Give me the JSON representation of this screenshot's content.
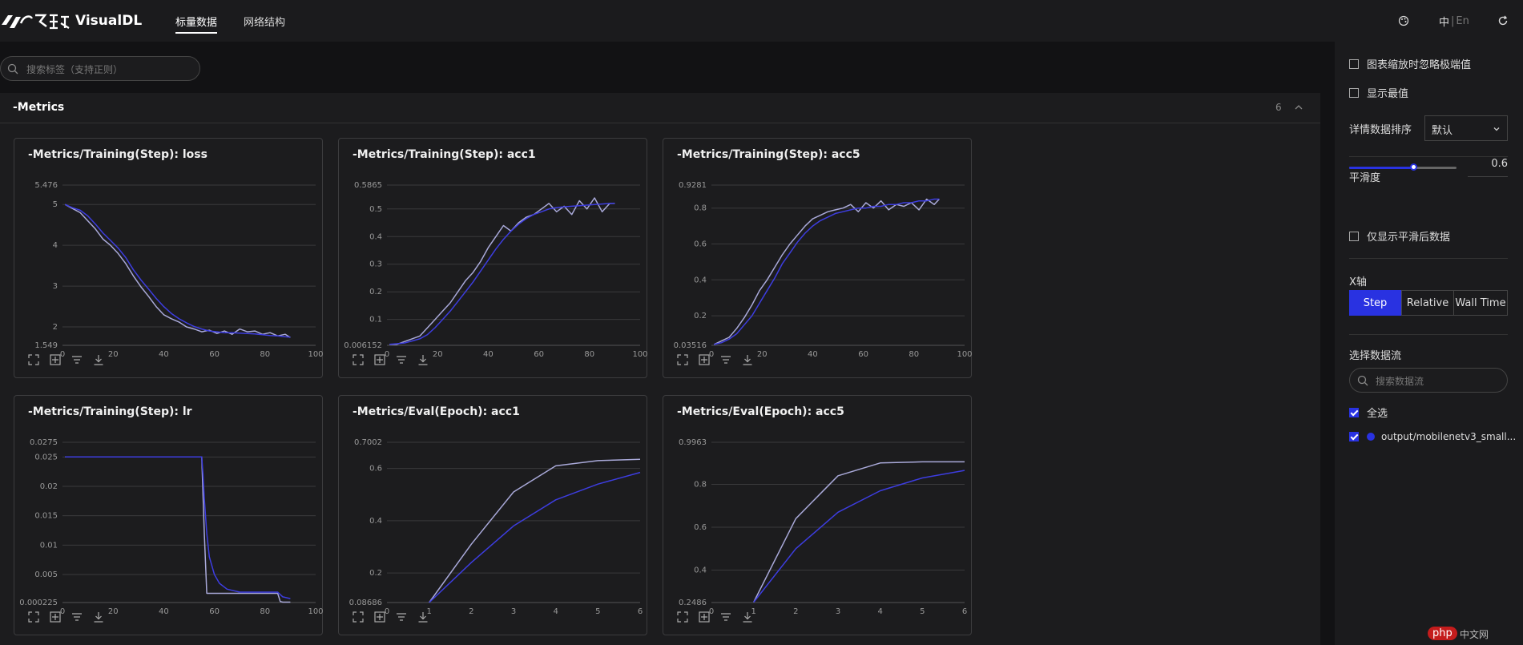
{
  "app": {
    "name": "VisualDL"
  },
  "nav": {
    "tabs": [
      {
        "label": "标量数据"
      },
      {
        "label": "网络结构"
      }
    ]
  },
  "topbar": {
    "lang_zh": "中",
    "lang_sep": "|",
    "lang_en": "En"
  },
  "search": {
    "placeholder": "搜索标签（支持正则）"
  },
  "section": {
    "title": "-Metrics",
    "count": "6"
  },
  "cards": [
    {
      "title": "-Metrics/Training(Step): loss",
      "chart_data": {
        "type": "line",
        "xlim": [
          0,
          100
        ],
        "ylim": [
          1.549,
          5.476
        ],
        "x_ticks": [
          "0",
          "20",
          "40",
          "60",
          "80",
          "100"
        ],
        "y_ticks": [
          {
            "label": "5.476",
            "v": 5.476
          },
          {
            "label": "5",
            "v": 5
          },
          {
            "label": "4",
            "v": 4
          },
          {
            "label": "3",
            "v": 3
          },
          {
            "label": "2",
            "v": 2
          },
          {
            "label": "1.549",
            "v": 1.549
          }
        ],
        "series": [
          {
            "x": [
              1,
              4,
              7,
              10,
              13,
              16,
              19,
              22,
              25,
              28,
              31,
              34,
              37,
              40,
              43,
              46,
              49,
              52,
              55,
              58,
              61,
              64,
              67,
              70,
              73,
              76,
              79,
              82,
              85,
              88,
              90
            ],
            "y": [
              5.0,
              4.92,
              4.86,
              4.72,
              4.52,
              4.3,
              4.12,
              3.93,
              3.7,
              3.4,
              3.15,
              2.93,
              2.7,
              2.5,
              2.33,
              2.2,
              2.1,
              2.01,
              1.95,
              1.9,
              1.88,
              1.86,
              1.86,
              1.85,
              1.84,
              1.83,
              1.81,
              1.79,
              1.78,
              1.76,
              1.75
            ]
          },
          {
            "x": [
              1,
              4,
              7,
              10,
              13,
              16,
              19,
              22,
              25,
              28,
              31,
              34,
              37,
              40,
              43,
              46,
              49,
              52,
              55,
              58,
              61,
              64,
              67,
              70,
              73,
              76,
              79,
              82,
              85,
              88,
              90
            ],
            "y": [
              5.0,
              4.9,
              4.8,
              4.6,
              4.4,
              4.15,
              4.0,
              3.8,
              3.55,
              3.25,
              2.98,
              2.75,
              2.5,
              2.3,
              2.2,
              2.12,
              2.0,
              1.95,
              1.88,
              1.92,
              1.84,
              1.9,
              1.82,
              1.95,
              1.88,
              1.9,
              1.82,
              1.86,
              1.78,
              1.82,
              1.74
            ]
          }
        ]
      }
    },
    {
      "title": "-Metrics/Training(Step): acc1",
      "chart_data": {
        "type": "line",
        "xlim": [
          0,
          100
        ],
        "ylim": [
          0.006152,
          0.5865
        ],
        "x_ticks": [
          "0",
          "20",
          "40",
          "60",
          "80",
          "100"
        ],
        "y_ticks": [
          {
            "label": "0.5865",
            "v": 0.5865
          },
          {
            "label": "0.5",
            "v": 0.5
          },
          {
            "label": "0.4",
            "v": 0.4
          },
          {
            "label": "0.3",
            "v": 0.3
          },
          {
            "label": "0.2",
            "v": 0.2
          },
          {
            "label": "0.1",
            "v": 0.1
          },
          {
            "label": "0.006152",
            "v": 0.006152
          }
        ],
        "series": [
          {
            "x": [
              1,
              4,
              7,
              10,
              13,
              16,
              19,
              22,
              25,
              28,
              31,
              34,
              37,
              40,
              43,
              46,
              49,
              52,
              55,
              58,
              61,
              64,
              67,
              70,
              73,
              76,
              79,
              82,
              85,
              88,
              90
            ],
            "y": [
              0.01,
              0.012,
              0.015,
              0.022,
              0.03,
              0.045,
              0.07,
              0.1,
              0.13,
              0.165,
              0.2,
              0.235,
              0.275,
              0.315,
              0.355,
              0.39,
              0.42,
              0.445,
              0.465,
              0.48,
              0.49,
              0.5,
              0.505,
              0.508,
              0.51,
              0.512,
              0.514,
              0.516,
              0.518,
              0.52,
              0.521
            ]
          },
          {
            "x": [
              1,
              4,
              7,
              10,
              13,
              16,
              19,
              22,
              25,
              28,
              31,
              34,
              37,
              40,
              43,
              46,
              49,
              52,
              55,
              58,
              61,
              64,
              67,
              70,
              73,
              76,
              79,
              82,
              85,
              88,
              90
            ],
            "y": [
              0.01,
              0.01,
              0.02,
              0.03,
              0.04,
              0.07,
              0.1,
              0.13,
              0.16,
              0.2,
              0.24,
              0.27,
              0.31,
              0.36,
              0.4,
              0.44,
              0.42,
              0.45,
              0.47,
              0.48,
              0.5,
              0.52,
              0.49,
              0.51,
              0.48,
              0.53,
              0.5,
              0.54,
              0.49,
              0.52,
              0.52
            ]
          }
        ]
      }
    },
    {
      "title": "-Metrics/Training(Step): acc5",
      "chart_data": {
        "type": "line",
        "xlim": [
          0,
          100
        ],
        "ylim": [
          0.03516,
          0.9281
        ],
        "x_ticks": [
          "0",
          "20",
          "40",
          "60",
          "80",
          "100"
        ],
        "y_ticks": [
          {
            "label": "0.9281",
            "v": 0.9281
          },
          {
            "label": "0.8",
            "v": 0.8
          },
          {
            "label": "0.6",
            "v": 0.6
          },
          {
            "label": "0.4",
            "v": 0.4
          },
          {
            "label": "0.2",
            "v": 0.2
          },
          {
            "label": "0.03516",
            "v": 0.03516
          }
        ],
        "series": [
          {
            "x": [
              1,
              4,
              7,
              10,
              13,
              16,
              19,
              22,
              25,
              28,
              31,
              34,
              37,
              40,
              43,
              46,
              49,
              52,
              55,
              58,
              61,
              64,
              67,
              70,
              73,
              76,
              79,
              82,
              85,
              88,
              90
            ],
            "y": [
              0.04,
              0.05,
              0.07,
              0.1,
              0.15,
              0.2,
              0.27,
              0.34,
              0.41,
              0.49,
              0.55,
              0.61,
              0.66,
              0.7,
              0.73,
              0.75,
              0.77,
              0.78,
              0.79,
              0.8,
              0.8,
              0.81,
              0.81,
              0.82,
              0.82,
              0.83,
              0.83,
              0.84,
              0.84,
              0.85,
              0.85
            ]
          },
          {
            "x": [
              1,
              4,
              7,
              10,
              13,
              16,
              19,
              22,
              25,
              28,
              31,
              34,
              37,
              40,
              43,
              46,
              49,
              52,
              55,
              58,
              61,
              64,
              67,
              70,
              73,
              76,
              79,
              82,
              85,
              88,
              90
            ],
            "y": [
              0.04,
              0.06,
              0.08,
              0.13,
              0.19,
              0.26,
              0.34,
              0.4,
              0.47,
              0.54,
              0.6,
              0.65,
              0.7,
              0.74,
              0.76,
              0.78,
              0.79,
              0.8,
              0.82,
              0.78,
              0.83,
              0.8,
              0.84,
              0.79,
              0.82,
              0.81,
              0.83,
              0.79,
              0.85,
              0.82,
              0.85
            ]
          }
        ]
      }
    },
    {
      "title": "-Metrics/Training(Step): lr",
      "chart_data": {
        "type": "line",
        "xlim": [
          0,
          100
        ],
        "ylim": [
          0.000225,
          0.0275
        ],
        "x_ticks": [
          "0",
          "20",
          "40",
          "60",
          "80",
          "100"
        ],
        "y_ticks": [
          {
            "label": "0.0275",
            "v": 0.0275
          },
          {
            "label": "0.025",
            "v": 0.025
          },
          {
            "label": "0.02",
            "v": 0.02
          },
          {
            "label": "0.015",
            "v": 0.015
          },
          {
            "label": "0.01",
            "v": 0.01
          },
          {
            "label": "0.005",
            "v": 0.005
          },
          {
            "label": "0.000225",
            "v": 0.000225
          }
        ],
        "series": [
          {
            "x": [
              1,
              55,
              55.5,
              56,
              57,
              58,
              60,
              62,
              65,
              70,
              75,
              80,
              85,
              87,
              90
            ],
            "y": [
              0.025,
              0.025,
              0.022,
              0.018,
              0.012,
              0.008,
              0.005,
              0.0035,
              0.0025,
              0.002,
              0.002,
              0.002,
              0.002,
              0.0012,
              0.0009
            ]
          },
          {
            "x": [
              1,
              55,
              56,
              57,
              85,
              86,
              87,
              90
            ],
            "y": [
              0.025,
              0.025,
              0.012,
              0.0018,
              0.0018,
              0.0004,
              0.0003,
              0.0003
            ]
          }
        ]
      }
    },
    {
      "title": "-Metrics/Eval(Epoch): acc1",
      "chart_data": {
        "type": "line",
        "xlim": [
          0,
          6
        ],
        "ylim": [
          0.08686,
          0.7002
        ],
        "x_ticks": [
          "0",
          "1",
          "2",
          "3",
          "4",
          "5",
          "6"
        ],
        "y_ticks": [
          {
            "label": "0.7002",
            "v": 0.7002
          },
          {
            "label": "0.6",
            "v": 0.6
          },
          {
            "label": "0.4",
            "v": 0.4
          },
          {
            "label": "0.2",
            "v": 0.2
          },
          {
            "label": "0.08686",
            "v": 0.08686
          }
        ],
        "series": [
          {
            "x": [
              1,
              2,
              3,
              4,
              5,
              6
            ],
            "y": [
              0.087,
              0.24,
              0.38,
              0.48,
              0.54,
              0.585
            ]
          },
          {
            "x": [
              1,
              2,
              3,
              4,
              5,
              6
            ],
            "y": [
              0.087,
              0.31,
              0.51,
              0.61,
              0.63,
              0.635
            ]
          }
        ]
      }
    },
    {
      "title": "-Metrics/Eval(Epoch): acc5",
      "chart_data": {
        "type": "line",
        "xlim": [
          0,
          6
        ],
        "ylim": [
          0.2486,
          0.9963
        ],
        "x_ticks": [
          "0",
          "1",
          "2",
          "3",
          "4",
          "5",
          "6"
        ],
        "y_ticks": [
          {
            "label": "0.9963",
            "v": 0.9963
          },
          {
            "label": "0.8",
            "v": 0.8
          },
          {
            "label": "0.6",
            "v": 0.6
          },
          {
            "label": "0.4",
            "v": 0.4
          },
          {
            "label": "0.2486",
            "v": 0.2486
          }
        ],
        "series": [
          {
            "x": [
              1,
              2,
              3,
              4,
              5,
              6
            ],
            "y": [
              0.25,
              0.5,
              0.67,
              0.77,
              0.83,
              0.865
            ]
          },
          {
            "x": [
              1,
              2,
              3,
              4,
              5,
              6
            ],
            "y": [
              0.25,
              0.64,
              0.84,
              0.9,
              0.905,
              0.905
            ]
          }
        ]
      }
    }
  ],
  "colors": {
    "series_main": "#3d3de0",
    "series_raw": "#a9a9d9",
    "grid": "#3a3a3c",
    "accent": "#2932e1"
  },
  "sidebar": {
    "ignore_outliers": "图表缩放时忽略极端值",
    "show_extremes": "显示最值",
    "sort_label": "详情数据排序",
    "sort_value": "默认",
    "smoothing_label": "平滑度",
    "smoothing_value": "0.6",
    "smoothing_level": 0.6,
    "show_smoothed_only": "仅显示平滑后数据",
    "xaxis_label": "X轴",
    "xaxis_options": [
      "Step",
      "Relative",
      "Wall Time"
    ],
    "xaxis_selected": "Step",
    "datastream_label": "选择数据流",
    "datastream_search_placeholder": "搜索数据流",
    "select_all": "全选",
    "run_name": "output/mobilenetv3_small..."
  },
  "watermark": {
    "badge": "php",
    "text": "中文网"
  }
}
